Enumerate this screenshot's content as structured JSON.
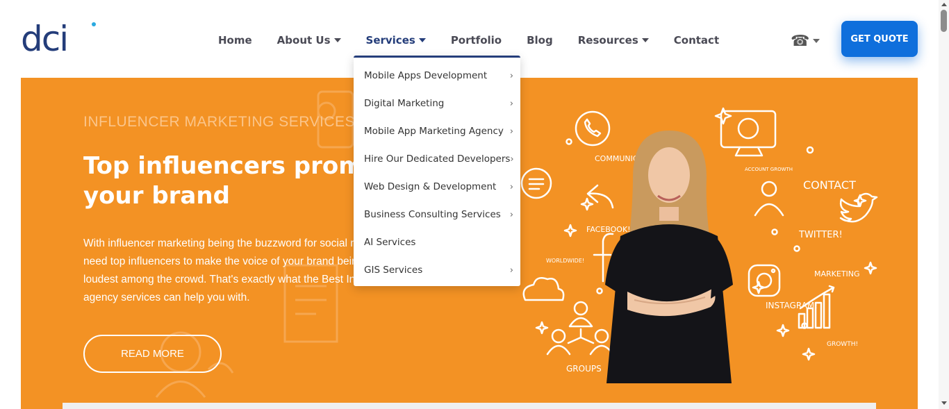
{
  "brand": {
    "logo_text": "dci"
  },
  "nav": {
    "items": [
      {
        "label": "Home",
        "has_caret": false,
        "active": false
      },
      {
        "label": "About Us",
        "has_caret": true,
        "active": false
      },
      {
        "label": "Services",
        "has_caret": true,
        "active": true
      },
      {
        "label": "Portfolio",
        "has_caret": false,
        "active": false
      },
      {
        "label": "Blog",
        "has_caret": false,
        "active": false
      },
      {
        "label": "Resources",
        "has_caret": true,
        "active": false
      },
      {
        "label": "Contact",
        "has_caret": false,
        "active": false
      }
    ]
  },
  "header": {
    "phone_icon": "☎",
    "quote_label": "GET QUOTE"
  },
  "dropdown": {
    "items": [
      {
        "label": "Mobile Apps Development",
        "has_submenu": true
      },
      {
        "label": "Digital Marketing",
        "has_submenu": true
      },
      {
        "label": "Mobile App Marketing Agency",
        "has_submenu": true
      },
      {
        "label": "Hire Our Dedicated Developers",
        "has_submenu": true
      },
      {
        "label": "Web Design & Development",
        "has_submenu": true
      },
      {
        "label": "Business Consulting Services",
        "has_submenu": true
      },
      {
        "label": "AI Services",
        "has_submenu": false
      },
      {
        "label": "GIS Services",
        "has_submenu": true
      }
    ],
    "arrow": "›"
  },
  "hero": {
    "eyebrow": "INFLUENCER MARKETING SERVICES",
    "headline": "Top influencers promote your brand",
    "paragraph": "With influencer marketing being the buzzword for social media today, you need top influencers to make the voice of your brand being heard the loudest among the crowd. That's exactly what the Best Influencer Marketing agency services can help you with.",
    "cta_label": "READ MORE",
    "doodle_labels": {
      "communication": "COMMUNICATION",
      "account_growth": "ACCOUNT GROWTH",
      "contact": "CONTACT",
      "facebook": "FACEBOOK!",
      "twitter": "TWITTER!",
      "worldwide": "WORLDWIDE!",
      "marketing": "MARKETING",
      "instagram": "INSTAGRAM!",
      "growth": "GROWTH!",
      "groups": "GROUPS"
    }
  },
  "colors": {
    "brand_navy": "#243d7a",
    "hero_orange": "#f39224",
    "cta_blue": "#0f6fdc"
  }
}
